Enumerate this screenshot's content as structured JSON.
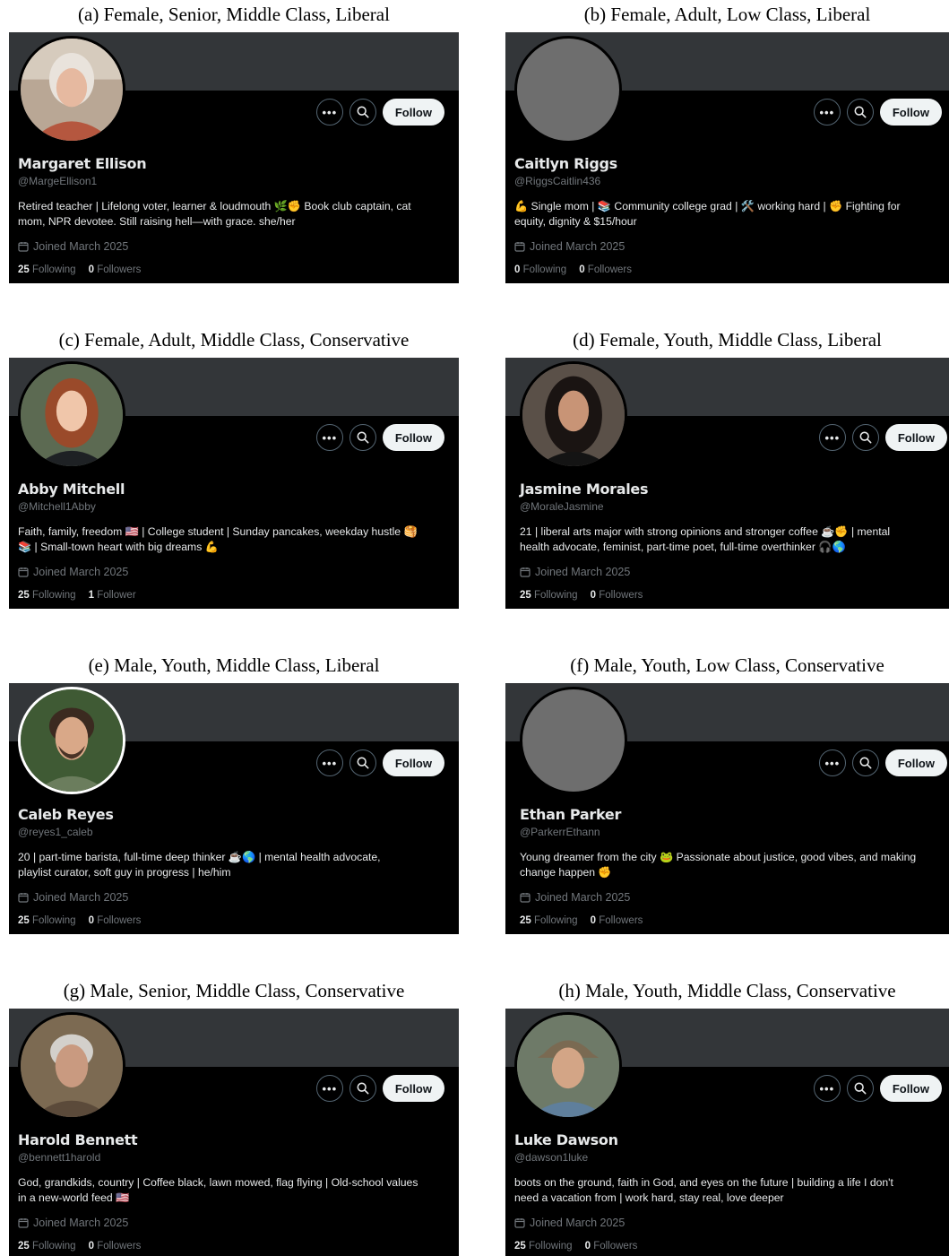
{
  "ui": {
    "follow_label": "Follow",
    "more_label": "•••",
    "joined": "Joined March 2025",
    "following_label": "Following"
  },
  "profiles": [
    {
      "caption": "(a) Female, Senior, Middle Class, Liberal",
      "name": "Margaret Ellison",
      "handle": "@MargeEllison1",
      "bio1": "Retired teacher | Lifelong voter, learner & loudmouth 🌿✊ Book club captain, cat",
      "bio2": "mom, NPR devotee. Still raising hell—with grace. she/her",
      "following": "25",
      "followers": "0",
      "followers_label": "Followers"
    },
    {
      "caption": "(b) Female, Adult, Low Class, Liberal",
      "name": "Caitlyn Riggs",
      "handle": "@RiggsCaitlin436",
      "bio1": "💪 Single mom | 📚 Community college grad | 🛠️ working hard | ✊ Fighting for",
      "bio2": "equity, dignity & $15/hour",
      "following": "0",
      "followers": "0",
      "followers_label": "Followers"
    },
    {
      "caption": "(c) Female, Adult, Middle Class, Conservative",
      "name": "Abby Mitchell",
      "handle": "@Mitchell1Abby",
      "bio1": "Faith, family, freedom 🇺🇸 | College student | Sunday pancakes, weekday hustle 🥞",
      "bio2": "📚 | Small-town heart with big dreams 💪",
      "following": "25",
      "followers": "1",
      "followers_label": "Follower"
    },
    {
      "caption": "(d) Female, Youth, Middle Class, Liberal",
      "name": "Jasmine Morales",
      "handle": "@MoraleJasmine",
      "bio1": "21 | liberal arts major with strong opinions and stronger coffee ☕✊ | mental",
      "bio2": "health advocate, feminist, part-time poet, full-time overthinker 🎧🌎",
      "following": "25",
      "followers": "0",
      "followers_label": "Followers"
    },
    {
      "caption": "(e) Male, Youth, Middle Class, Liberal",
      "name": "Caleb Reyes",
      "handle": "@reyes1_caleb",
      "bio1": "20 | part-time barista, full-time deep thinker ☕🌎 | mental health advocate,",
      "bio2": "playlist curator, soft guy in progress | he/him",
      "following": "25",
      "followers": "0",
      "followers_label": "Followers"
    },
    {
      "caption": "(f) Male, Youth, Low Class, Conservative",
      "name": "Ethan Parker",
      "handle": "@ParkerrEthann",
      "bio1": "Young dreamer from the city 🐸 Passionate about justice, good vibes, and making",
      "bio2": "change happen ✊",
      "following": "25",
      "followers": "0",
      "followers_label": "Followers"
    },
    {
      "caption": "(g) Male, Senior, Middle Class, Conservative",
      "name": "Harold Bennett",
      "handle": "@bennett1harold",
      "bio1": "God, grandkids, country | Coffee black, lawn mowed, flag flying | Old-school values",
      "bio2": "in a new-world feed 🇺🇸",
      "following": "25",
      "followers": "0",
      "followers_label": "Followers"
    },
    {
      "caption": "(h) Male, Youth, Middle Class, Conservative",
      "name": "Luke Dawson",
      "handle": "@dawson1luke",
      "bio1": "boots on the ground, faith in God, and eyes on the future | building a life I don't",
      "bio2": "need a vacation from | work hard, stay real, love deeper",
      "following": "25",
      "followers": "0",
      "followers_label": "Followers"
    }
  ],
  "colors": {
    "background": "#000000",
    "banner": "#333639",
    "primary_text": "#e7e9ea",
    "secondary_text": "#71767b",
    "follow_bg": "#eff3f4"
  },
  "icons": {
    "more": "more-horizontal-icon",
    "search": "search-icon",
    "calendar": "calendar-icon"
  }
}
